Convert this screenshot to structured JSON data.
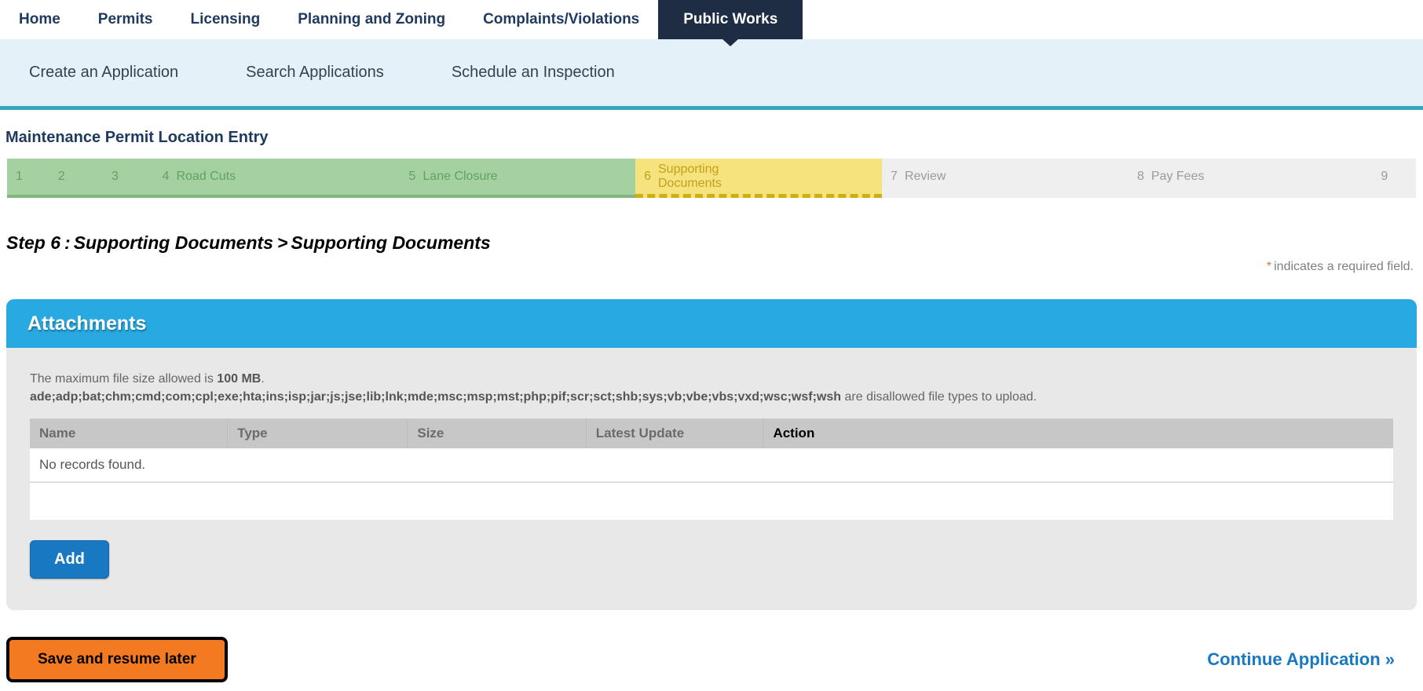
{
  "nav": {
    "items": [
      {
        "label": "Home",
        "active": false
      },
      {
        "label": "Permits",
        "active": false
      },
      {
        "label": "Licensing",
        "active": false
      },
      {
        "label": "Planning and Zoning",
        "active": false
      },
      {
        "label": "Complaints/Violations",
        "active": false
      },
      {
        "label": "Public Works",
        "active": true
      }
    ]
  },
  "subnav": {
    "items": [
      {
        "label": "Create an Application"
      },
      {
        "label": "Search Applications"
      },
      {
        "label": "Schedule an Inspection"
      }
    ]
  },
  "page": {
    "title": "Maintenance Permit Location Entry"
  },
  "stepper": {
    "steps": [
      {
        "num": "1",
        "label": "",
        "state": "done"
      },
      {
        "num": "2",
        "label": "",
        "state": "done"
      },
      {
        "num": "3",
        "label": "",
        "state": "done"
      },
      {
        "num": "4",
        "label": "Road Cuts",
        "state": "done"
      },
      {
        "num": "5",
        "label": "Lane Closure",
        "state": "done"
      },
      {
        "num": "6",
        "label": "Supporting Documents",
        "state": "current"
      },
      {
        "num": "7",
        "label": "Review",
        "state": "todo"
      },
      {
        "num": "8",
        "label": "Pay Fees",
        "state": "todo"
      },
      {
        "num": "9",
        "label": "",
        "state": "todo"
      }
    ]
  },
  "step_heading": {
    "step": "Step 6",
    "colon": ":",
    "section": "Supporting Documents",
    "separator": ">",
    "subsection": "Supporting Documents"
  },
  "required_note": {
    "asterisk": "*",
    "text": "indicates a required field."
  },
  "attachments": {
    "title": "Attachments",
    "max_file_prefix": "The maximum file size allowed is ",
    "max_file_size": "100 MB",
    "max_file_suffix": ".",
    "disallowed_types": "ade;adp;bat;chm;cmd;com;cpl;exe;hta;ins;isp;jar;js;jse;lib;lnk;mde;msc;msp;mst;php;pif;scr;sct;shb;sys;vb;vbe;vbs;vxd;wsc;wsf;wsh",
    "disallowed_suffix": " are disallowed file types to upload.",
    "table": {
      "columns": {
        "name": "Name",
        "type": "Type",
        "size": "Size",
        "latest_update": "Latest Update",
        "action": "Action"
      },
      "empty_text": "No records found."
    },
    "add_button_label": "Add"
  },
  "footer": {
    "save_button_label": "Save and resume later",
    "continue_link_label": "Continue Application »"
  },
  "colors": {
    "active_tab_bg": "#1f2d44",
    "subnav_bg": "#e4f1f9",
    "subnav_border": "#35a6bd",
    "step_done_bg": "#a5d0a2",
    "step_current_bg": "#f6e37e",
    "step_todo_bg": "#efefef",
    "panel_header_bg": "#29a9e1",
    "panel_body_bg": "#e8e8e8",
    "add_button_bg": "#1878c2",
    "save_button_bg": "#f47a21",
    "link_blue": "#1878c2"
  }
}
